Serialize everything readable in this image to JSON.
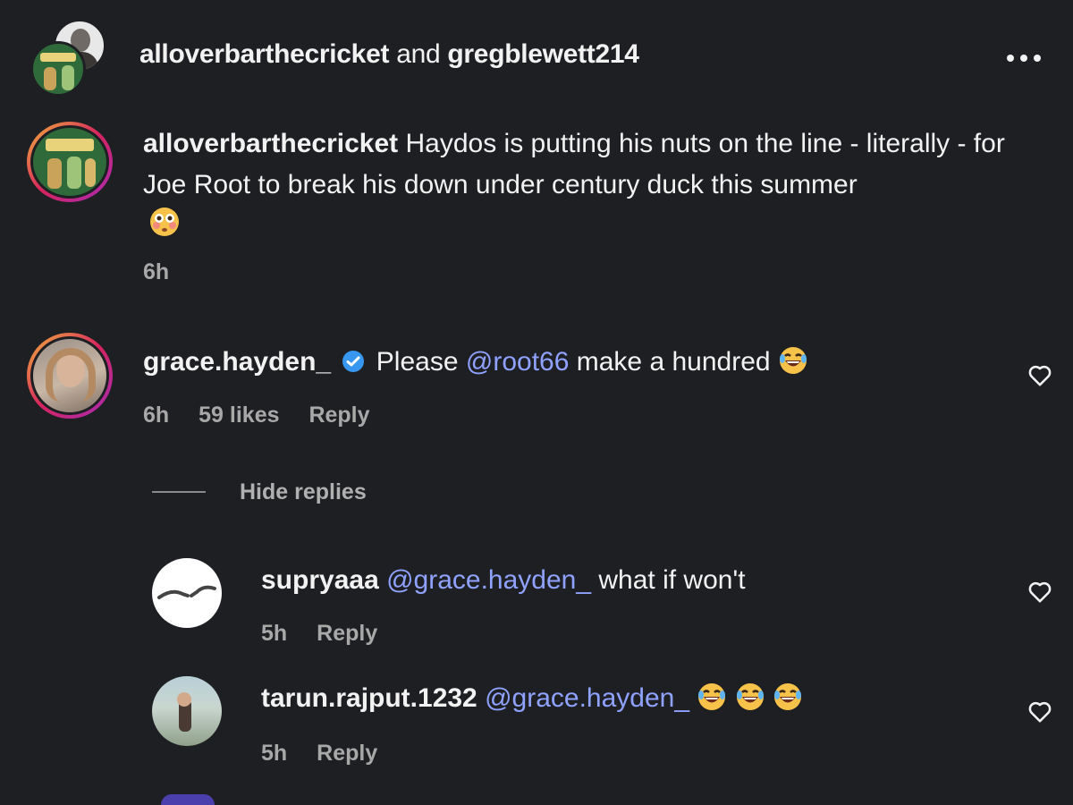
{
  "header": {
    "user1": "alloverbarthecricket",
    "conj": "and",
    "user2": "gregblewett214",
    "more_icon": "ellipsis-icon"
  },
  "caption": {
    "username": "alloverbarthecricket",
    "text": "Haydos is putting his nuts on the line - literally - for Joe Root to break his down under century duck this summer",
    "emoji": "flushed-face",
    "time": "6h"
  },
  "comments": [
    {
      "username": "grace.hayden_",
      "verified": true,
      "text_before": "Please",
      "mention": "@root66",
      "text_after": "make a hundred",
      "emoji": "laughing-face",
      "time": "6h",
      "likes": "59 likes",
      "reply": "Reply"
    }
  ],
  "hide_replies": "Hide replies",
  "replies": [
    {
      "username": "supryaaa",
      "mention": "@grace.hayden_",
      "text": "what if won't",
      "time": "5h",
      "reply": "Reply"
    },
    {
      "username": "tarun.rajput.1232",
      "mention": "@grace.hayden_",
      "emoji": "laughing-face x3",
      "time": "5h",
      "reply": "Reply"
    }
  ],
  "colors": {
    "background": "#1e1f23",
    "mention": "#8fa2ff",
    "verified": "#3897f0",
    "meta": "#a8a8a8"
  }
}
